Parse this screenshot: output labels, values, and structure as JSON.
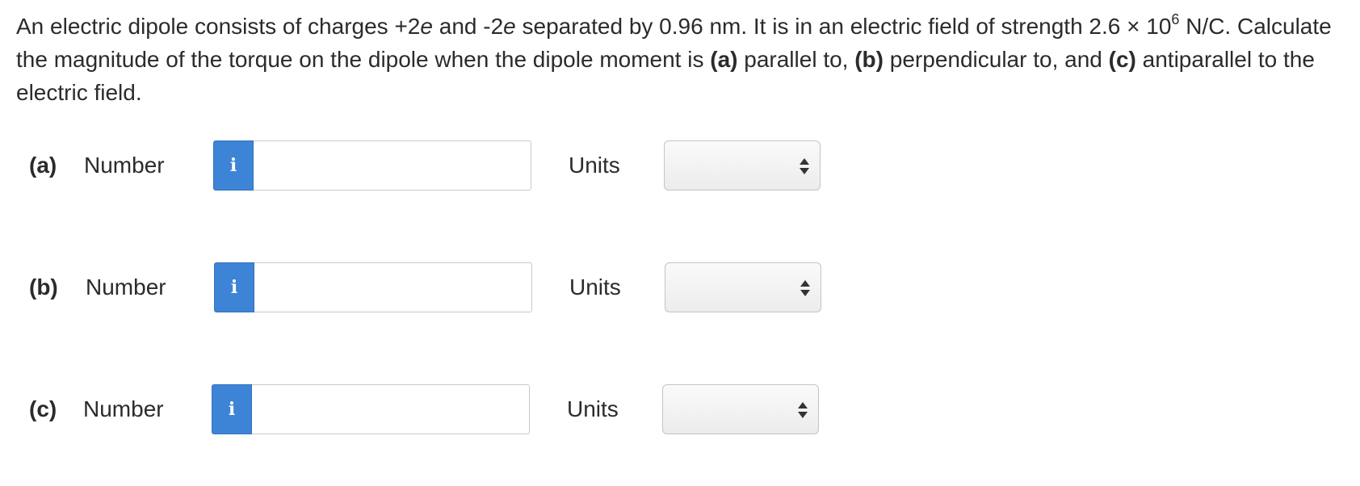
{
  "question": {
    "intro": "An electric dipole consists of charges +2",
    "e1": "e",
    "and_minus": " and -2",
    "e2": "e",
    "separation": " separated by 0.96 nm. It is in an electric field of strength 2.6 × 10",
    "exponent": "6",
    "unit_and_calc": " N/C. Calculate the magnitude of the torque on the dipole when the dipole moment is ",
    "part_a": "(a)",
    "text_a": " parallel to, ",
    "part_b": "(b)",
    "text_b": " perpendicular to, and ",
    "part_c": "(c)",
    "text_c": " antiparallel to the electric field."
  },
  "answers": [
    {
      "part": "(a)",
      "number_label": "Number",
      "info_icon": "i",
      "value": "",
      "units_label": "Units",
      "units_selected": ""
    },
    {
      "part": "(b)",
      "number_label": "Number",
      "info_icon": "i",
      "value": "",
      "units_label": "Units",
      "units_selected": ""
    },
    {
      "part": "(c)",
      "number_label": "Number",
      "info_icon": "i",
      "value": "",
      "units_label": "Units",
      "units_selected": ""
    }
  ],
  "colors": {
    "info_button": "#3d84d6",
    "text": "#2b2b2b",
    "input_border": "#c9c9c9"
  },
  "icons": {
    "info": "info-icon",
    "select_arrows": "up-down-arrows-icon"
  }
}
